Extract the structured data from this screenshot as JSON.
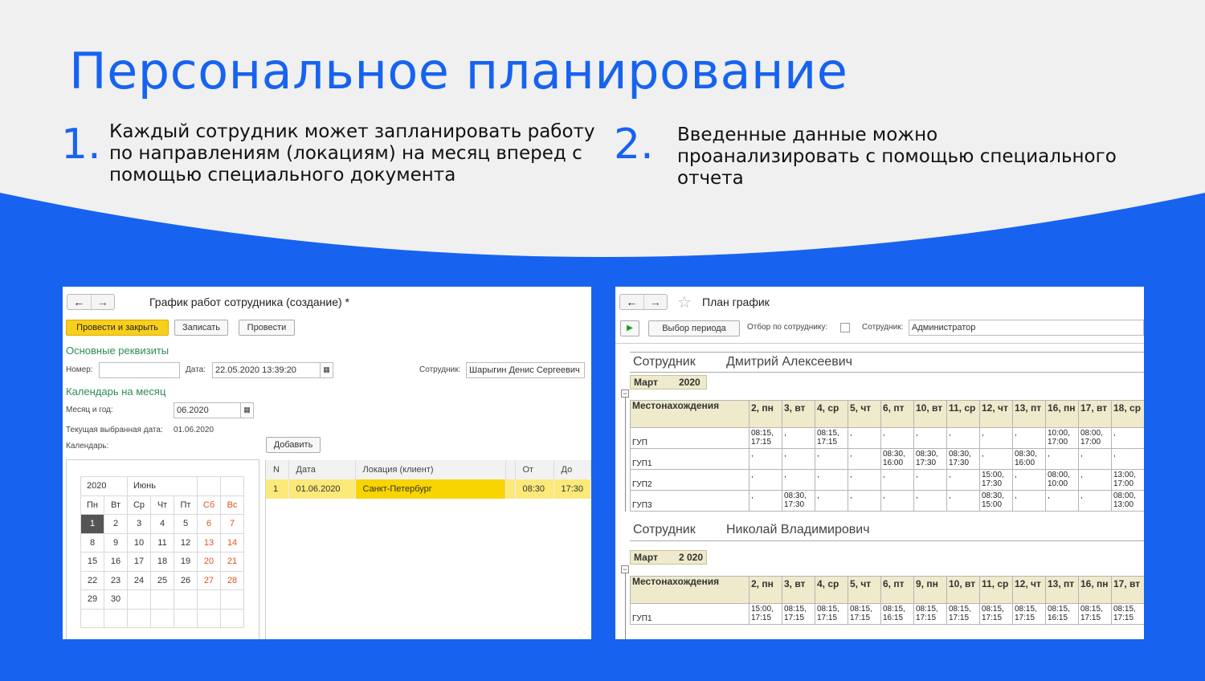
{
  "slide": {
    "title": "Персональное планирование",
    "point1_num": "1.",
    "point1_lines": [
      "Каждый сотрудник может запланировать работу",
      "по направлениям (локациям) на месяц вперед с",
      "помощью специального документа"
    ],
    "point2_num": "2.",
    "point2_lines": [
      "Введенные данные можно",
      "проанализировать с помощью специального",
      "отчета"
    ]
  },
  "left": {
    "nav_back": "←",
    "nav_fwd": "→",
    "title": "График работ сотрудника (создание) *",
    "btn_post_close": "Провести и закрыть",
    "btn_save": "Записать",
    "btn_post": "Провести",
    "section_main": "Основные реквизиты",
    "number_label": "Номер:",
    "number_value": "",
    "date_label": "Дата:",
    "date_value": "22.05.2020 13:39:20",
    "employee_label": "Сотрудник:",
    "employee_value": "Шарыгин Денис Сергеевич",
    "section_calendar": "Календарь на месяц",
    "month_label": "Месяц и год:",
    "month_value": "06.2020",
    "current_date_label": "Текущая выбранная дата:",
    "current_date_value": "01.06.2020",
    "calendar_label": "Календарь:",
    "btn_add": "Добавить",
    "calendar": {
      "year": "2020",
      "month": "Июнь",
      "weekdays": [
        "Пн",
        "Вт",
        "Ср",
        "Чт",
        "Пт",
        "Сб",
        "Вс"
      ],
      "weeks": [
        [
          "1",
          "2",
          "3",
          "4",
          "5",
          "6",
          "7"
        ],
        [
          "8",
          "9",
          "10",
          "11",
          "12",
          "13",
          "14"
        ],
        [
          "15",
          "16",
          "17",
          "18",
          "19",
          "20",
          "21"
        ],
        [
          "22",
          "23",
          "24",
          "25",
          "26",
          "27",
          "28"
        ],
        [
          "29",
          "30",
          "",
          "",
          "",
          "",
          ""
        ],
        [
          "",
          "",
          "",
          "",
          "",
          "",
          ""
        ]
      ],
      "selected": "1"
    },
    "grid": {
      "headers": [
        "N",
        "Дата",
        "Локация (клиент)",
        "",
        "От",
        "До"
      ],
      "rows": [
        [
          "1",
          "01.06.2020",
          "Санкт-Петербург",
          "",
          "08:30",
          "17:30"
        ]
      ]
    },
    "colors": {
      "accent_yellow": "#f8cf1c",
      "section_green": "#2e8b57",
      "weekend": "#e0531f"
    }
  },
  "right": {
    "nav_back": "←",
    "nav_fwd": "→",
    "star_icon": "☆",
    "title": "План график",
    "run_icon": "▶",
    "btn_period": "Выбор периода",
    "filter_label": "Отбор по сотруднику:",
    "employee_label": "Сотрудник:",
    "employee_value": "Администратор",
    "report1": {
      "emp_label": "Сотрудник",
      "emp_name": "Дмитрий Алексеевич",
      "month": "Март",
      "year": "2020",
      "loc_header": "Местонахождения",
      "days": [
        "2, пн",
        "3, вт",
        "4, ср",
        "5, чт",
        "6, пт",
        "10, вт",
        "11, ср",
        "12, чт",
        "13, пт",
        "16, пн",
        "17, вт",
        "18, ср"
      ],
      "rows": [
        {
          "loc": "ГУП",
          "cells": [
            "08:15, 17:15",
            ",",
            "08:15, 17:15",
            ",",
            ",",
            ",",
            ",",
            ",",
            ",",
            "10:00, 17:00",
            "08:00, 17:00",
            ","
          ]
        },
        {
          "loc": "ГУП1",
          "cells": [
            ",",
            ",",
            ",",
            ",",
            "08:30, 16:00",
            "08:30, 17:30",
            "08:30, 17:30",
            ",",
            "08:30, 16:00",
            ",",
            ",",
            ","
          ]
        },
        {
          "loc": "ГУП2",
          "cells": [
            ",",
            ",",
            ",",
            ",",
            ",",
            ",",
            ",",
            "15:00, 17:30",
            ",",
            "08:00, 10:00",
            ",",
            "13:00, 17:00"
          ]
        },
        {
          "loc": "ГУП3",
          "cells": [
            ",",
            "08:30, 17:30",
            ",",
            ",",
            ",",
            ",",
            ",",
            "08:30, 15:00",
            ",",
            ",",
            ",",
            "08:00, 13:00"
          ]
        }
      ]
    },
    "report2": {
      "emp_label": "Сотрудник",
      "emp_name": "Николай Владимирович",
      "month": "Март",
      "year": "2 020",
      "loc_header": "Местонахождения",
      "days": [
        "2, пн",
        "3, вт",
        "4, ср",
        "5, чт",
        "6, пт",
        "9, пн",
        "10, вт",
        "11, ср",
        "12, чт",
        "13, пт",
        "16, пн",
        "17, вт"
      ],
      "rows": [
        {
          "loc": "ГУП1",
          "cells": [
            "15:00, 17:15",
            "08:15, 17:15",
            "08:15, 17:15",
            "08:15, 17:15",
            "08:15, 16:15",
            "08:15, 17:15",
            "08:15, 17:15",
            "08:15, 17:15",
            "08:15, 17:15",
            "08:15, 16:15",
            "08:15, 17:15",
            "08:15, 17:15"
          ]
        }
      ]
    },
    "colors": {
      "header_bg": "#eeeacb"
    }
  },
  "colors": {
    "brand_blue": "#1763f0",
    "bg_light": "#f0f0f0"
  }
}
